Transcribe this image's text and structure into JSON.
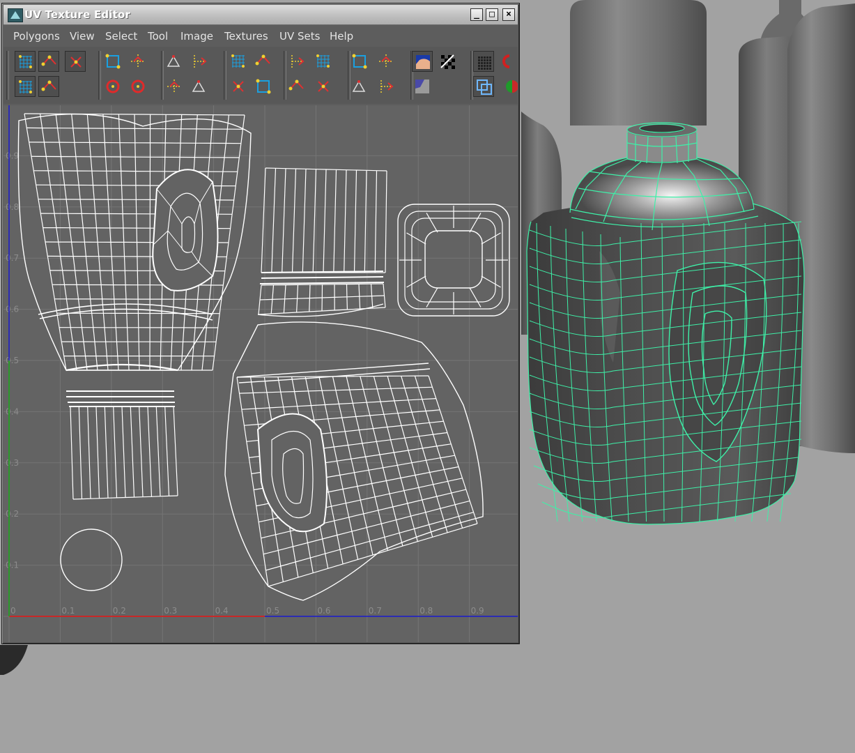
{
  "window": {
    "title": "UV Texture Editor",
    "minimize_glyph": "_",
    "maximize_glyph": "□",
    "close_glyph": "×"
  },
  "menu": [
    "Polygons",
    "View",
    "Select",
    "Tool",
    "Image",
    "Textures",
    "UV Sets",
    "Help"
  ],
  "toolbar_icons": [
    "uv-grid-icon",
    "move-uv-icon",
    "uv-snapshot-icon",
    "flip-u-icon",
    "flip-v-icon",
    "cut-uv-icon",
    "sew-uv-icon",
    "layout-icon",
    "unfold-icon",
    "rotate-ccw-icon",
    "rotate-cw-icon",
    "straighten-icon",
    "align-icon",
    "align-left-icon",
    "align-right-icon",
    "align-bottom-icon",
    "align-top-icon",
    "select-shell-icon",
    "select-border-icon",
    "grow-selection-icon",
    "shrink-selection-icon",
    "display-image-icon",
    "checker-icon",
    "pixel-snap-icon",
    "magnet-icon",
    "isolate-icon",
    "shading-icon",
    "dim-image-icon"
  ],
  "axes": {
    "u_labels": [
      "0",
      "0.1",
      "0.2",
      "0.3",
      "0.4",
      "0.5",
      "0.6",
      "0.7",
      "0.8",
      "0.9"
    ],
    "v_labels": [
      "0.9",
      "0.8",
      "0.7",
      "0.6",
      "0.5",
      "0.4",
      "0.3",
      "0.2",
      "0.1"
    ]
  },
  "colors": {
    "wire_highlight": "#3ef0a8",
    "u_axis": "#c82828",
    "v_axis": "#2a9a2a",
    "uv_border": "#1a1ad0"
  }
}
